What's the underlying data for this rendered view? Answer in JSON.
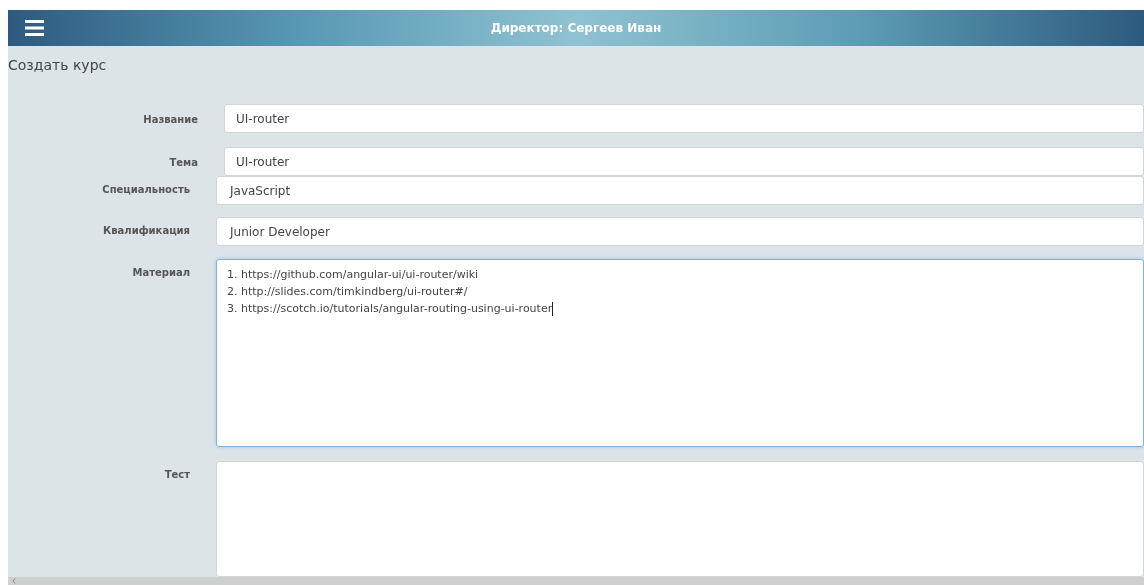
{
  "header": {
    "title": "Директор: Сергеев Иван"
  },
  "page_title": "Создать курс",
  "fields": [
    {
      "label": "Название",
      "kind": "input",
      "value": "UI-router",
      "focused": false
    },
    {
      "label": "Тема",
      "kind": "input",
      "value": "UI-router",
      "focused": false
    },
    {
      "label": "Специальность",
      "kind": "input",
      "value": "JavaScript",
      "focused": false
    },
    {
      "label": "Квалификация",
      "kind": "input",
      "value": "Junior Developer",
      "focused": false
    },
    {
      "label": "Материал",
      "kind": "textarea",
      "lines": [
        "1. https://github.com/angular-ui/ui-router/wiki",
        "2. http://slides.com/timkindberg/ui-router#/",
        "3. https://scotch.io/tutorials/angular-routing-using-ui-router"
      ],
      "focused": true
    },
    {
      "label": "Тест",
      "kind": "textarea",
      "focused": false
    }
  ]
}
